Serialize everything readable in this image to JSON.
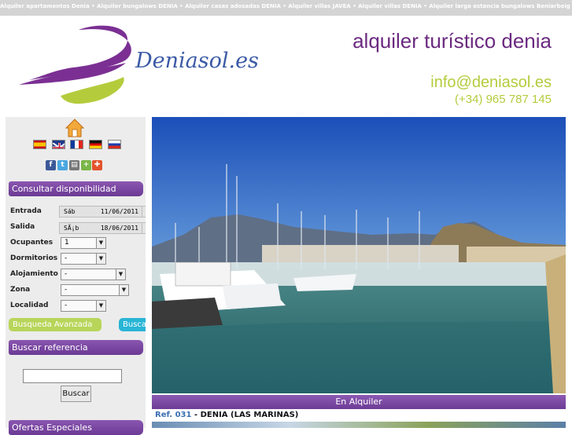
{
  "top_links": "Alquiler apartamentos Denia • Alquiler bungalows DENIA • Alquiler casas adosadas DENIA • Alquiler villas JAVEA • Alquiler villas DENIA • Alquiler larga estancia bungalows Beniarbeig •",
  "brand": {
    "logo_text": "Deniasol.es",
    "tagline": "alquiler turístico denia",
    "email": "info@deniasol.es",
    "phone": "(+34) 965 787 145"
  },
  "languages": [
    "es",
    "en",
    "fr",
    "de",
    "ru"
  ],
  "social_icons": [
    "facebook-icon",
    "twitter-icon",
    "print-icon",
    "share-icon",
    "add-icon"
  ],
  "availability": {
    "title": "Consultar disponibilidad",
    "check_in_label": "Entrada",
    "check_in_day": "Sáb",
    "check_in_date": "11/06/2011",
    "check_out_label": "Salida",
    "check_out_day": "SÃ¡b",
    "check_out_date": "18/06/2011",
    "occupants_label": "Ocupantes",
    "occupants_value": "1",
    "bedrooms_label": "Dormitorios",
    "bedrooms_value": "-",
    "lodging_label": "Alojamiento",
    "lodging_value": "-",
    "zone_label": "Zona",
    "zone_value": "-",
    "locality_label": "Localidad",
    "locality_value": "-",
    "advanced_button": "Busqueda Avanzada",
    "search_button": "Buscar"
  },
  "reference": {
    "title": "Buscar referencia",
    "button": "Buscar"
  },
  "offers": {
    "title": "Ofertas Especiales"
  },
  "rental": {
    "header": "En Alquiler",
    "ref_label": "Ref. 031",
    "ref_sep": " - ",
    "ref_location": "DENIA (LAS MARINAS)"
  },
  "colors": {
    "purple": "#6b2a80",
    "green": "#b4cc3c",
    "blue": "#3b5aa6",
    "cyan": "#28b5d6"
  }
}
